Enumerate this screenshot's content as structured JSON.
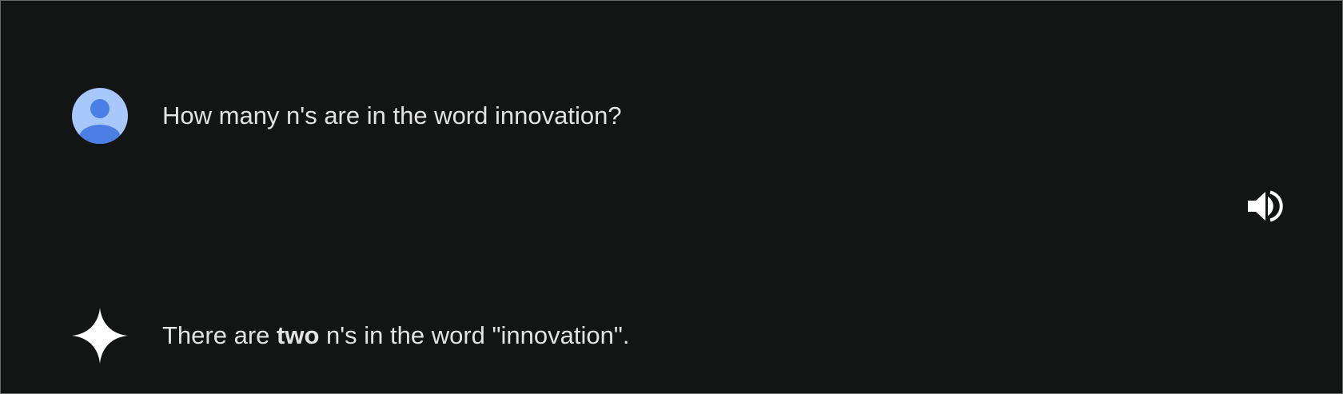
{
  "conversation": {
    "user_message": "How many n's are in the word innovation?",
    "response": {
      "prefix": "There are ",
      "emphasis": "two",
      "suffix": " n's in the word \"innovation\"."
    }
  },
  "icons": {
    "user_avatar": "user-avatar-icon",
    "read_aloud": "speaker-icon",
    "model": "sparkle-icon"
  },
  "colors": {
    "background": "#131414",
    "text": "#e3e3e3",
    "avatar_bg": "#a8c7fa",
    "avatar_fg": "#4a80e6"
  }
}
